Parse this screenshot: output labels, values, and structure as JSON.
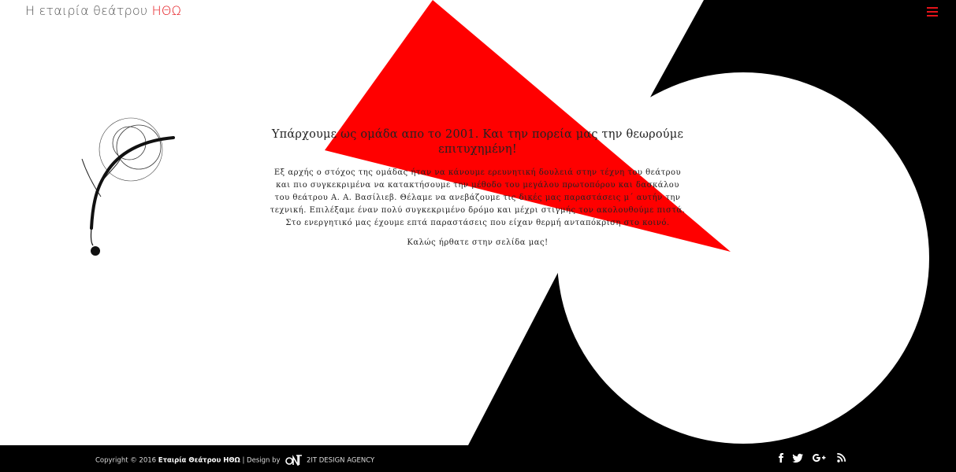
{
  "header": {
    "logo_text": "Η εταιρία θεάτρου",
    "logo_brand": "ΗΘΩ"
  },
  "main": {
    "heading": "Υπάρχουμε ως ομάδα απο το 2001. Και την πορεία μας την θεωρούμε επιτυχημένη!",
    "paragraph": "Εξ αρχής ο στόχος της ομάδας ήταν να κάνουμε ερευνητική δουλειά στην τέχνη του θεάτρου και πιο συγκεκριμένα να κατακτήσουμε την μέθοδο του μεγάλου πρωτοπόρου και δασκάλου του θεάτρου Α. Α. Βασίλιεβ. Θέλαμε να ανεβάζουμε τις δικές μας παραστάσεις μ΄ αυτήν την τεχνική. Επιλέξαμε έναν πολύ συγκεκριμένο δρόμο και μέχρι στιγμής τον ακολουθούμε πιστά. Στο ενεργητικό μας έχουμε επτά παραστάσεις που είχαν θερμή ανταπόκριση στο κοινό.",
    "welcome": "Καλώς ήρθατε στην σελίδα μας!"
  },
  "footer": {
    "copyright_prefix": "Copyright © 2016",
    "company": "Εταιρία Θεάτρου ΗΘΩ",
    "design_by": "| Design by",
    "agency": "2IT DESIGN AGENCY",
    "social": [
      "facebook-icon",
      "twitter-icon",
      "google-plus-icon",
      "rss-icon"
    ]
  },
  "colors": {
    "accent": "#e4141a",
    "dark": "#000000",
    "background": "#ffffff"
  }
}
